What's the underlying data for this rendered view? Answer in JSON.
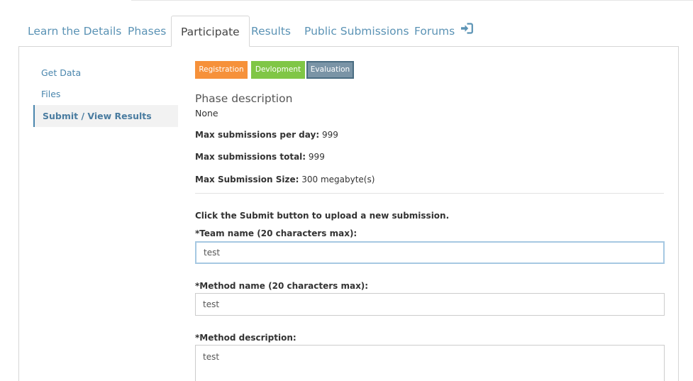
{
  "tabs": {
    "learn": "Learn the Details",
    "phases": "Phases",
    "participate": "Participate",
    "results": "Results",
    "public_submissions": "Public Submissions",
    "forums": "Forums",
    "forums_icon": "sign-in-icon"
  },
  "sidebar": {
    "items": [
      {
        "label": "Get Data"
      },
      {
        "label": "Files"
      },
      {
        "label": "Submit / View Results",
        "active": true
      }
    ]
  },
  "phases": {
    "buttons": [
      {
        "label": "Registration",
        "color": "#f6913a"
      },
      {
        "label": "Devlopment",
        "color": "#80c646"
      },
      {
        "label": "Evaluation",
        "color": "#7a94a6",
        "selected": true
      }
    ]
  },
  "phase_info": {
    "title": "Phase description",
    "description": "None",
    "max_per_day_label": "Max submissions per day:",
    "max_per_day_value": "999",
    "max_total_label": "Max submissions total:",
    "max_total_value": "999",
    "max_size_label": "Max Submission Size:",
    "max_size_value": "300 megabyte(s)"
  },
  "form": {
    "instruction": "Click the Submit button to upload a new submission.",
    "team_label": "*Team name (20 characters max):",
    "team_value": "test",
    "method_label": "*Method name (20 characters max):",
    "method_value": "test",
    "description_label": "*Method description:",
    "description_value": "test"
  },
  "colors": {
    "link": "#5b93b5",
    "active_border": "#4a86ad",
    "focus_border": "#a6c8e2"
  }
}
